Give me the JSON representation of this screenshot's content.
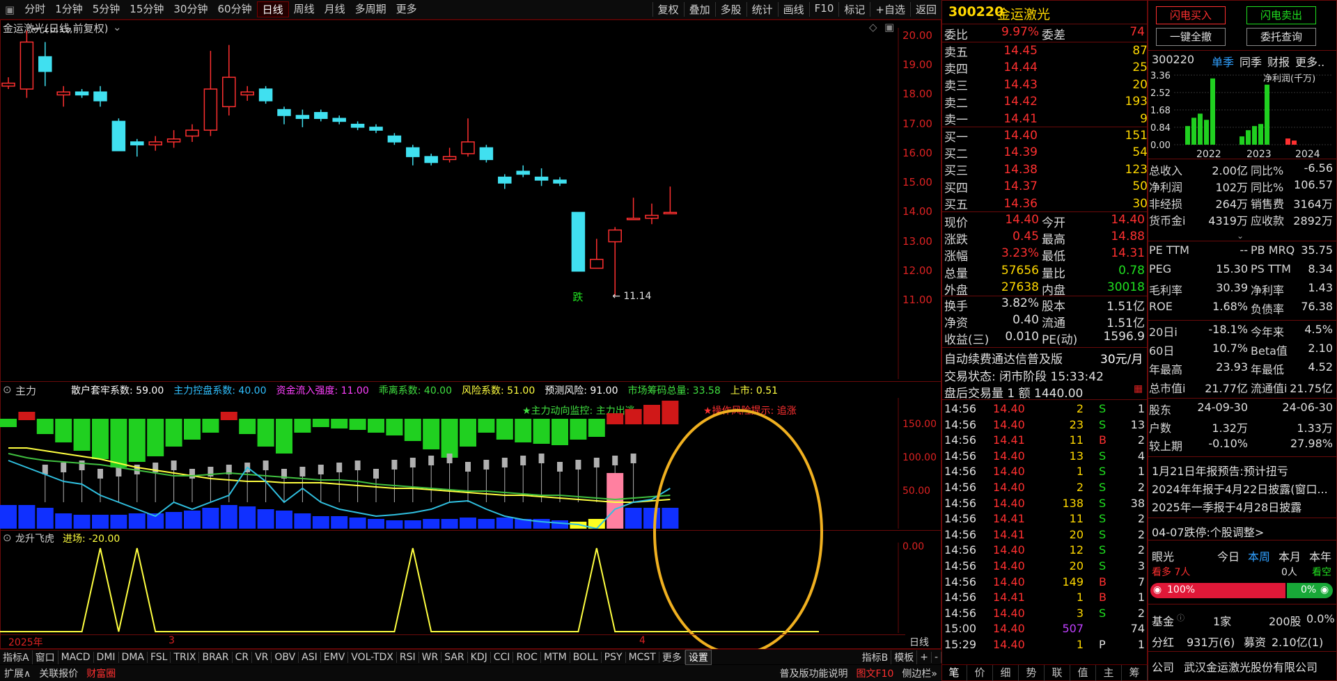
{
  "toolbar": {
    "periods": [
      "分时",
      "1分钟",
      "5分钟",
      "15分钟",
      "30分钟",
      "60分钟",
      "日线",
      "周线",
      "月线",
      "多周期",
      "更多"
    ],
    "active": "日线",
    "right": [
      "复权",
      "叠加",
      "多股",
      "统计",
      "画线",
      "F10",
      "标记",
      "+自选",
      "返回"
    ]
  },
  "chart": {
    "title": "金运激光(日线,前复权)",
    "high_label": "20.19",
    "low_label": "11.14",
    "limit_down_label": "跌",
    "price_axis": [
      "20.00",
      "19.00",
      "18.00",
      "17.00",
      "16.00",
      "15.00",
      "14.00",
      "13.00",
      "12.00",
      "11.00"
    ],
    "candles": [
      {
        "o": 18.3,
        "c": 18.4,
        "h": 18.6,
        "l": 18.2
      },
      {
        "o": 18.2,
        "c": 19.8,
        "h": 20.19,
        "l": 17.9
      },
      {
        "o": 19.3,
        "c": 18.8,
        "h": 19.8,
        "l": 18.3
      },
      {
        "o": 18.0,
        "c": 18.1,
        "h": 18.3,
        "l": 17.6
      },
      {
        "o": 18.1,
        "c": 18.0,
        "h": 18.2,
        "l": 17.9
      },
      {
        "o": 18.1,
        "c": 17.8,
        "h": 18.3,
        "l": 17.6
      },
      {
        "o": 17.1,
        "c": 16.1,
        "h": 17.2,
        "l": 16.1
      },
      {
        "o": 16.4,
        "c": 16.3,
        "h": 16.5,
        "l": 15.9
      },
      {
        "o": 16.3,
        "c": 16.4,
        "h": 16.6,
        "l": 16.1
      },
      {
        "o": 16.4,
        "c": 16.5,
        "h": 16.8,
        "l": 16.2
      },
      {
        "o": 16.6,
        "c": 16.8,
        "h": 17.0,
        "l": 16.4
      },
      {
        "o": 16.8,
        "c": 18.2,
        "h": 19.5,
        "l": 16.6
      },
      {
        "o": 17.6,
        "c": 18.6,
        "h": 19.7,
        "l": 17.3
      },
      {
        "o": 18.0,
        "c": 18.1,
        "h": 18.3,
        "l": 17.8
      },
      {
        "o": 18.2,
        "c": 17.8,
        "h": 18.3,
        "l": 17.7
      },
      {
        "o": 17.5,
        "c": 17.3,
        "h": 17.6,
        "l": 17.0
      },
      {
        "o": 17.3,
        "c": 17.2,
        "h": 17.5,
        "l": 16.9
      },
      {
        "o": 17.4,
        "c": 17.2,
        "h": 17.5,
        "l": 17.1
      },
      {
        "o": 17.2,
        "c": 17.1,
        "h": 17.3,
        "l": 17.0
      },
      {
        "o": 17.0,
        "c": 16.9,
        "h": 17.1,
        "l": 16.8
      },
      {
        "o": 16.9,
        "c": 16.8,
        "h": 17.0,
        "l": 16.7
      },
      {
        "o": 16.6,
        "c": 16.4,
        "h": 16.7,
        "l": 16.3
      },
      {
        "o": 16.2,
        "c": 15.9,
        "h": 16.3,
        "l": 15.6
      },
      {
        "o": 15.9,
        "c": 15.7,
        "h": 16.0,
        "l": 15.6
      },
      {
        "o": 15.8,
        "c": 15.9,
        "h": 16.2,
        "l": 15.7
      },
      {
        "o": 16.0,
        "c": 16.4,
        "h": 17.2,
        "l": 15.9
      },
      {
        "o": 16.2,
        "c": 15.8,
        "h": 16.3,
        "l": 15.7
      },
      {
        "o": 15.2,
        "c": 15.0,
        "h": 15.3,
        "l": 14.8
      },
      {
        "o": 15.4,
        "c": 15.3,
        "h": 15.6,
        "l": 15.2
      },
      {
        "o": 15.2,
        "c": 15.1,
        "h": 15.5,
        "l": 14.9
      },
      {
        "o": 15.1,
        "c": 15.0,
        "h": 15.2,
        "l": 14.9
      },
      {
        "o": 14.0,
        "c": 12.0,
        "h": 14.0,
        "l": 12.0
      },
      {
        "o": 12.1,
        "c": 12.4,
        "h": 13.1,
        "l": 12.1
      },
      {
        "o": 13.0,
        "c": 13.4,
        "h": 13.5,
        "l": 11.14
      },
      {
        "o": 13.8,
        "c": 13.8,
        "h": 14.5,
        "l": 13.8
      },
      {
        "o": 13.8,
        "c": 13.9,
        "h": 14.3,
        "l": 13.6
      },
      {
        "o": 14.0,
        "c": 14.0,
        "h": 14.88,
        "l": 14.0
      }
    ]
  },
  "indicator1": {
    "name": "主力",
    "items": [
      {
        "label": "散户套牢系数: 59.00",
        "color": "#ffffff"
      },
      {
        "label": "主力控盘系数: 40.00",
        "color": "#30c0ff"
      },
      {
        "label": "资金流入强度: 11.00",
        "color": "#ff40ff"
      },
      {
        "label": "乖离系数: 40.00",
        "color": "#40e040"
      },
      {
        "label": "风险系数: 51.00",
        "color": "#ffff40"
      },
      {
        "label": "预测风险: 91.00",
        "color": "#ffffff"
      },
      {
        "label": "市场筹码总量: 33.58",
        "color": "#40e040"
      },
      {
        "label": "上市: 0.51",
        "color": "#ffff40"
      }
    ],
    "signal1": "★主力动向监控: 主力出逃",
    "signal2": "★操作风险提示: 追涨",
    "axis": [
      "150.00",
      "100.00",
      "50.00"
    ]
  },
  "indicator2": {
    "name": "龙升飞虎",
    "value": "进场: -20.00",
    "axis": "0.00"
  },
  "dates": [
    "2025年",
    "3",
    "4"
  ],
  "axis_unit": "日线",
  "bottom_tabs": [
    "指标A",
    "窗口",
    "MACD",
    "DMI",
    "DMA",
    "FSL",
    "TRIX",
    "BRAR",
    "CR",
    "VR",
    "OBV",
    "ASI",
    "EMV",
    "VOL-TDX",
    "RSI",
    "WR",
    "SAR",
    "KDJ",
    "CCI",
    "ROC",
    "MTM",
    "BOLL",
    "PSY",
    "MCST",
    "更多",
    "设置"
  ],
  "bottom_right": [
    "指标B",
    "模板",
    "+",
    "-"
  ],
  "status": [
    "扩展∧",
    "关联报价",
    "财富圈"
  ],
  "status_right": [
    "普及版功能说明",
    "图文F10",
    "侧边栏»"
  ],
  "quote": {
    "code": "300220",
    "name": "金运激光",
    "wb_label": "委比",
    "wb": "9.97%",
    "wc_label": "委差",
    "wc": "74",
    "asks": [
      [
        "卖五",
        "14.45",
        "87"
      ],
      [
        "卖四",
        "14.44",
        "25"
      ],
      [
        "卖三",
        "14.43",
        "20"
      ],
      [
        "卖二",
        "14.42",
        "193"
      ],
      [
        "卖一",
        "14.41",
        "9"
      ]
    ],
    "bids": [
      [
        "买一",
        "14.40",
        "151"
      ],
      [
        "买二",
        "14.39",
        "54"
      ],
      [
        "买三",
        "14.38",
        "123"
      ],
      [
        "买四",
        "14.37",
        "50"
      ],
      [
        "买五",
        "14.36",
        "30"
      ]
    ],
    "stats1": [
      [
        "现价",
        "14.40",
        "今开",
        "14.40"
      ],
      [
        "涨跌",
        "0.45",
        "最高",
        "14.88"
      ],
      [
        "涨幅",
        "3.23%",
        "最低",
        "14.31"
      ],
      [
        "总量",
        "57656",
        "量比",
        "0.78"
      ],
      [
        "外盘",
        "27638",
        "内盘",
        "30018"
      ]
    ],
    "stats2": [
      [
        "换手",
        "3.82%",
        "股本",
        "1.51亿"
      ],
      [
        "净资",
        "0.40",
        "流通",
        "1.51亿"
      ],
      [
        "收益(三)",
        "0.010",
        "PE(动)",
        "1596.9"
      ]
    ],
    "promo": "自动续费通达信普及版",
    "promo_price": "30元/月",
    "trade_state": "交易状态: 闭市阶段 15:33:42",
    "after_hours": "盘后交易量 1 额 1440.00",
    "ticks": [
      [
        "14:56",
        "14.40",
        "2",
        "S",
        "1"
      ],
      [
        "14:56",
        "14.40",
        "23",
        "S",
        "13"
      ],
      [
        "14:56",
        "14.41",
        "11",
        "B",
        "2"
      ],
      [
        "14:56",
        "14.40",
        "13",
        "S",
        "4"
      ],
      [
        "14:56",
        "14.40",
        "1",
        "S",
        "1"
      ],
      [
        "14:56",
        "14.40",
        "2",
        "S",
        "2"
      ],
      [
        "14:56",
        "14.40",
        "138",
        "S",
        "38"
      ],
      [
        "14:56",
        "14.41",
        "11",
        "S",
        "2"
      ],
      [
        "14:56",
        "14.41",
        "20",
        "S",
        "2"
      ],
      [
        "14:56",
        "14.40",
        "12",
        "S",
        "2"
      ],
      [
        "14:56",
        "14.40",
        "20",
        "S",
        "3"
      ],
      [
        "14:56",
        "14.40",
        "149",
        "B",
        "7"
      ],
      [
        "14:56",
        "14.41",
        "1",
        "B",
        "1"
      ],
      [
        "14:56",
        "14.40",
        "3",
        "S",
        "2"
      ],
      [
        "15:00",
        "14.40",
        "507",
        "",
        "74"
      ],
      [
        "15:29",
        "14.40",
        "1",
        "P",
        "1"
      ]
    ],
    "tabs": [
      "笔",
      "价",
      "细",
      "势",
      "联",
      "值",
      "主",
      "筹"
    ]
  },
  "fin": {
    "buy_flash": "闪电买入",
    "sell_flash": "闪电卖出",
    "cancel_all": "一键全撤",
    "query": "委托查询",
    "code": "300220",
    "tabs": [
      "单季",
      "同季",
      "财报",
      "更多.."
    ],
    "chart_label": "净利润(千万)",
    "chart_data": {
      "type": "bar",
      "ylim": [
        0,
        3.36
      ],
      "yticks": [
        "3.36",
        "2.52",
        "1.68",
        "0.84",
        "0.00"
      ],
      "categories": [
        "2022",
        "2023",
        "2024"
      ],
      "values": [
        0.9,
        1.3,
        1.5,
        1.2,
        3.2,
        0.4,
        0.7,
        0.9,
        1.0,
        2.9,
        0.3,
        0.2
      ],
      "colors": [
        "#20d020",
        "#20d020",
        "#20d020",
        "#20d020",
        "#20d020",
        "#20d020",
        "#20d020",
        "#20d020",
        "#20d020",
        "#20d020",
        "#ff3030",
        "#ff3030"
      ]
    },
    "rows1": [
      [
        "总收入",
        "2.00亿",
        "同比%",
        "-6.56"
      ],
      [
        "净利润",
        "102万",
        "同比%",
        "106.57"
      ],
      [
        "非经损",
        "264万",
        "销售费",
        "3164万"
      ],
      [
        "货币金i",
        "4319万",
        "应收款",
        "2892万"
      ]
    ],
    "rows2": [
      [
        "PE TTM",
        "--",
        "PB MRQ",
        "35.75"
      ],
      [
        "PEG",
        "15.30",
        "PS TTM",
        "8.34"
      ],
      [
        "毛利率",
        "30.39",
        "净利率",
        "1.43"
      ],
      [
        "ROE",
        "1.68%",
        "负债率",
        "76.38"
      ]
    ],
    "rows3": [
      [
        "20日i",
        "-18.1%",
        "今年来",
        "4.5%"
      ],
      [
        "60日",
        "10.7%",
        "Beta值",
        "2.10"
      ],
      [
        "年最高",
        "23.93",
        "年最低",
        "4.52"
      ],
      [
        "总市值i",
        "21.77亿",
        "流通值i",
        "21.75亿"
      ]
    ],
    "rows4": [
      [
        "股东",
        "24-09-30",
        "",
        "24-06-30"
      ],
      [
        "户数",
        "1.32万",
        "",
        "1.33万"
      ],
      [
        "较上期",
        "-0.10%",
        "",
        "27.98%"
      ]
    ],
    "news": [
      "1月21日年报预告:预计扭亏",
      "2024年年报于4月22日披露(窗口...",
      "2025年一季报于4月28日披露"
    ],
    "limit": "04-07跌停:个股调整>",
    "eye_label": "眼光",
    "periods": [
      "今日",
      "本周",
      "本月",
      "本年"
    ],
    "bull": "看多 7人",
    "bull_count": "7人",
    "bear_count": "0人",
    "bear": "看空",
    "bull_pct": "100%",
    "bear_pct": "0%",
    "fund_label": "基金",
    "fund_val": "1家",
    "fund_shares": "200股",
    "fund_pct": "0.0%",
    "div_label": "分红",
    "div_val": "931万(6)",
    "raise_label": "募资",
    "raise_val": "2.10亿(1)",
    "company_label": "公司",
    "company": "武汉金运激光股份有限公司"
  }
}
